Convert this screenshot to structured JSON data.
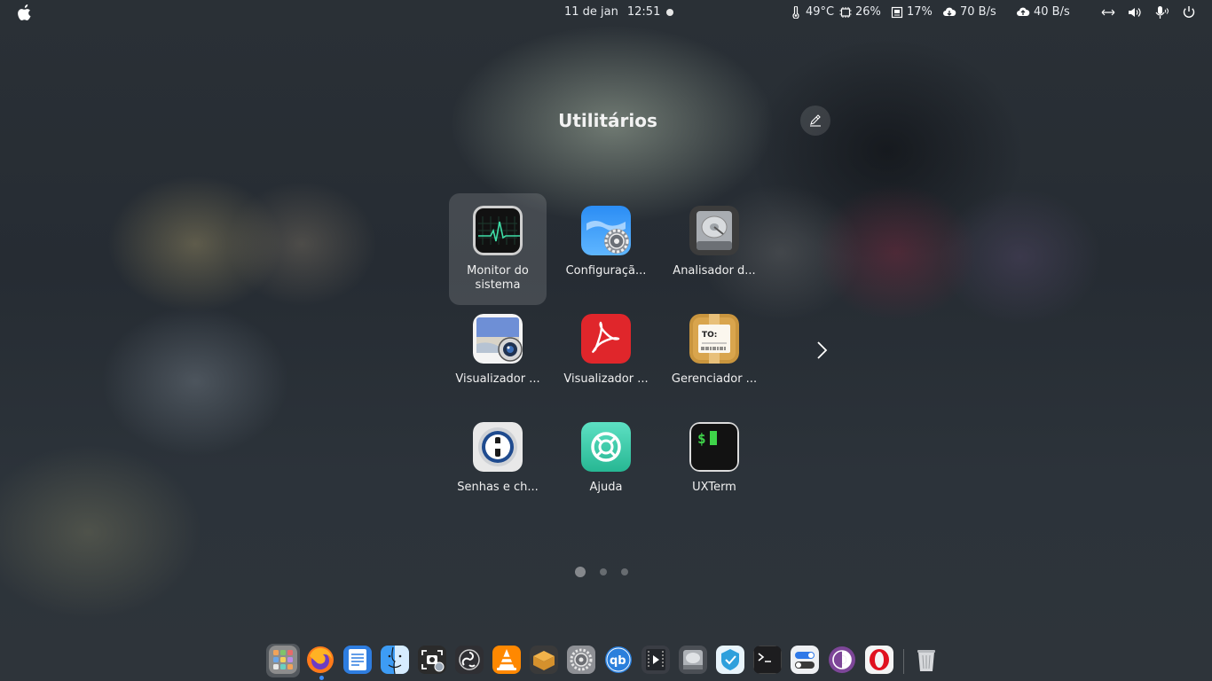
{
  "topbar": {
    "date": "11 de jan",
    "time": "12:51",
    "temperature": "49°C",
    "cpu": "26%",
    "memory": "17%",
    "download": "70 B/s",
    "upload": "40 B/s"
  },
  "folder": {
    "title": "Utilitários",
    "apps": [
      {
        "label": "Monitor do sistema",
        "icon": "system-monitor-icon",
        "selected": true
      },
      {
        "label": "Configuraçã...",
        "icon": "settings-icon"
      },
      {
        "label": "Analisador d...",
        "icon": "disk-analyzer-icon"
      },
      {
        "label": "Visualizador ...",
        "icon": "image-viewer-icon"
      },
      {
        "label": "Visualizador ...",
        "icon": "pdf-viewer-icon"
      },
      {
        "label": "Gerenciador ...",
        "icon": "package-manager-icon"
      },
      {
        "label": "Senhas e ch...",
        "icon": "passwords-keys-icon"
      },
      {
        "label": "Ajuda",
        "icon": "help-icon"
      },
      {
        "label": "UXTerm",
        "icon": "terminal-icon"
      }
    ],
    "pages": 3,
    "current_page": 1
  },
  "dock": {
    "apps": [
      "launchpad-icon",
      "firefox-icon",
      "text-editor-icon",
      "finder-icon",
      "screenshot-icon",
      "obs-icon",
      "vlc-icon",
      "archive-manager-icon",
      "system-settings-icon",
      "qbittorrent-icon",
      "video-editor-icon",
      "disk-utility-icon",
      "shield-app-icon",
      "terminal-icon",
      "tweaks-icon",
      "tor-browser-icon",
      "opera-icon",
      "trash-icon"
    ]
  }
}
